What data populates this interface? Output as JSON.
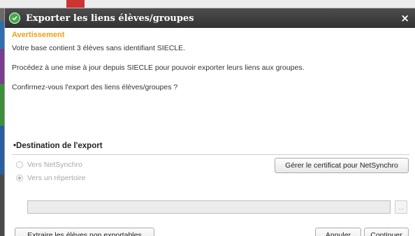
{
  "dialog": {
    "title": "Exporter les liens élèves/groupes",
    "close_glyph": "×",
    "warning_title": "Avertissement",
    "messages": [
      "Votre base contient 3 élèves sans identifiant SIECLE.",
      "Procédez à une mise à jour depuis SIECLE pour pouvoir exporter leurs liens aux groupes.",
      "Confirmez-vous l'export des liens élèves/groupes ?"
    ],
    "section_title": "•Destination de l'export",
    "options": {
      "netsynchro_label": "Vers NetSynchro",
      "directory_label": "Vers un répertoire",
      "selected": "directory"
    },
    "path_value": "",
    "browse_label": "...",
    "buttons": {
      "certificate": "Gérer le certificat pour NetSynchro",
      "extract": "Extraire les élèves non exportables",
      "cancel": "Annuler",
      "continue": "Continuer"
    }
  },
  "colors": {
    "titlebar": "#3a3a3a",
    "warning": "#f39c12",
    "title_icon": "#3fae45",
    "disabled_text": "#a8a8a8"
  },
  "icons": {
    "title_icon": "circle-logo-icon",
    "close": "close-icon"
  }
}
